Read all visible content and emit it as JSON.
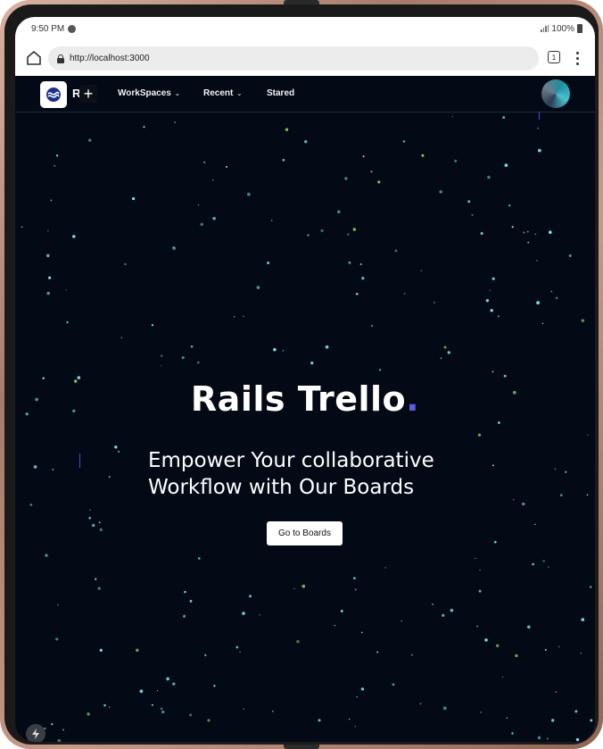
{
  "status": {
    "time": "9:50 PM",
    "battery": "100%"
  },
  "browser": {
    "url": "http://localhost:3000",
    "tab_count": "1"
  },
  "nav": {
    "brand_initial": "R",
    "plus": "+",
    "items": [
      {
        "label": "WorkSpaces",
        "has_dropdown": true
      },
      {
        "label": "Recent",
        "has_dropdown": true
      },
      {
        "label": "Stared",
        "has_dropdown": false
      }
    ]
  },
  "hero": {
    "title": "Rails Trello",
    "title_dot": ".",
    "subtitle": "Empower Your collaborative Workflow with Our Boards",
    "button": "Go to Boards"
  },
  "colors": {
    "background": "#030a16",
    "accent_dot": "#5c5ce0",
    "star_cyan": "#7fe9f2",
    "star_green": "#8fe36a"
  },
  "icons": {
    "home": "home-icon",
    "lock": "lock-icon",
    "tabs": "tabs-icon",
    "menu": "kebab-menu-icon",
    "logo": "trello-logo-icon",
    "fab": "lightning-icon"
  }
}
